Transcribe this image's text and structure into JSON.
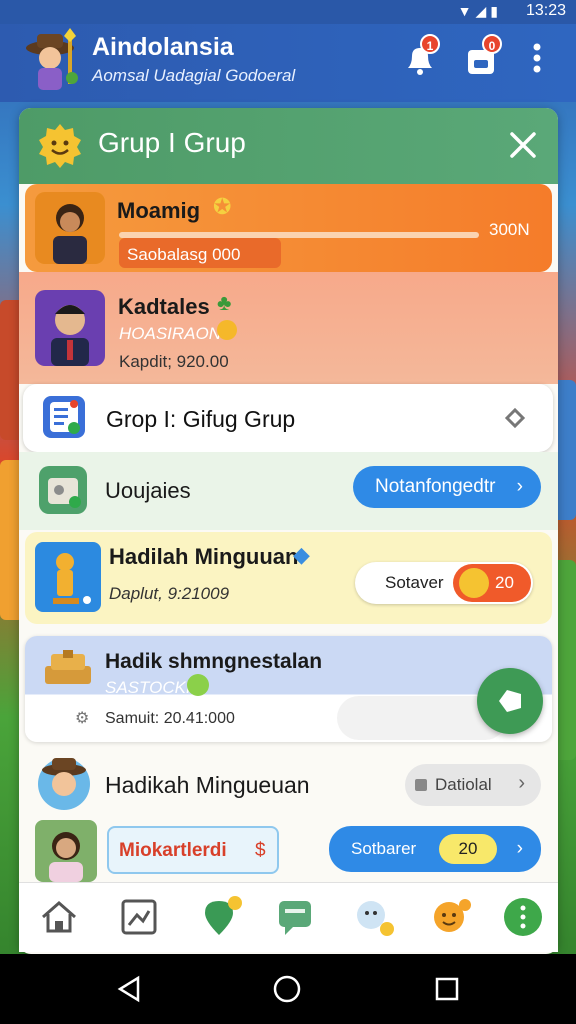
{
  "status_bar": {
    "time": "13:23"
  },
  "header": {
    "title": "Aindolansia",
    "subtitle": "Aomsal Uadagial Godoeral",
    "notification_badge": "1",
    "inbox_badge": "0"
  },
  "panel": {
    "title": "Grup I Grup",
    "rows": [
      {
        "name": "Moamig",
        "progress_label": "Saobalasg 000",
        "right_value": "300N",
        "progress": 0.45
      },
      {
        "name": "Kadtales",
        "sub": "HOASIRAON",
        "detail": "Kapdit; 920.00"
      },
      {
        "name": "Grop I: Gifug Grup"
      },
      {
        "name": "Uoujaies",
        "button": "Notanfongedtr"
      },
      {
        "name": "Hadilah Minguuan",
        "detail": "Daplut, 9:21009",
        "button": "Sotaver",
        "badge": "20"
      },
      {
        "name": "Hadik shmngnestalan",
        "sub": "SASTOCKI",
        "detail": "Samuit: 20.41:000"
      },
      {
        "name": "Hadikah Mingueuan",
        "button": "Datiolal"
      },
      {
        "name": "Miokartlerdi",
        "button": "Sotbarer",
        "badge": "20"
      }
    ]
  },
  "colors": {
    "accent_blue": "#2f8ae6",
    "header_green": "#4e9b67",
    "highlight_orange": "#f58a3c"
  }
}
